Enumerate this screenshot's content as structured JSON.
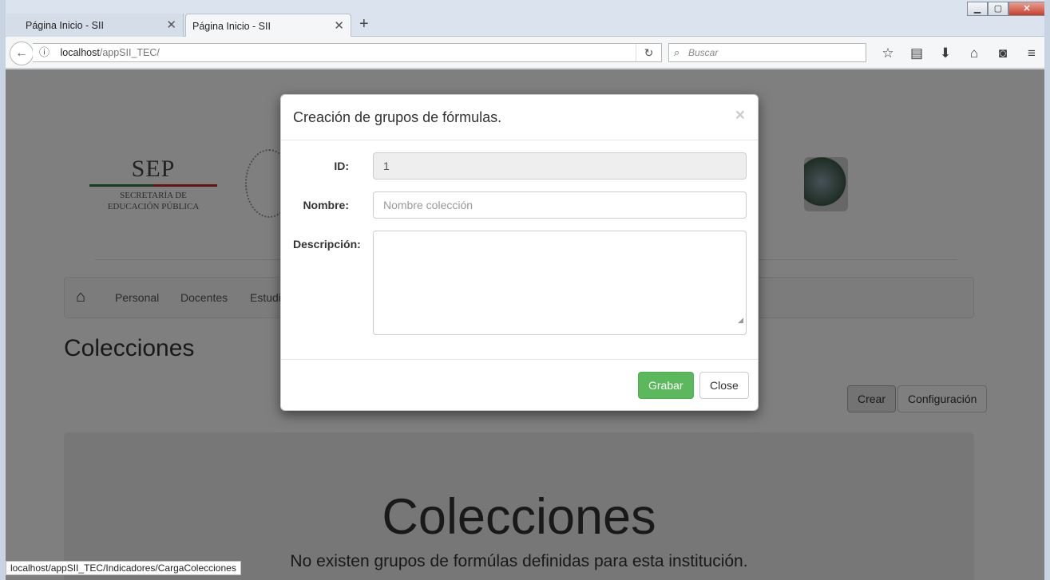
{
  "browser": {
    "tabs": [
      {
        "label": "Página Inicio - SII"
      },
      {
        "label": "Página Inicio - SII"
      }
    ],
    "url_host": "localhost",
    "url_path": "/appSII_TEC/",
    "search_placeholder": "Buscar",
    "status_url": "localhost/appSII_TEC/Indicadores/CargaColecciones"
  },
  "header": {
    "sep_logo": "SEP",
    "sep_line1": "SECRETARÍA DE",
    "sep_line2": "EDUCACIÓN PÚBLICA"
  },
  "menu": {
    "items": [
      "Personal",
      "Docentes",
      "Estudi"
    ]
  },
  "page": {
    "title": "Colecciones",
    "crear": "Crear",
    "configuracion": "Configuración",
    "jumbo_title": "Colecciones",
    "jumbo_text": "No existen grupos de formúlas definidas para esta institución."
  },
  "modal": {
    "title": "Creación de grupos de fórmulas.",
    "close_x": "×",
    "id_label": "ID:",
    "id_value": "1",
    "nombre_label": "Nombre:",
    "nombre_placeholder": "Nombre colección",
    "descripcion_label": "Descripción:",
    "grabar": "Grabar",
    "close": "Close"
  },
  "colors": {
    "grabar": "#5cb85c",
    "backdrop": "rgba(0,0,0,0.5)"
  }
}
